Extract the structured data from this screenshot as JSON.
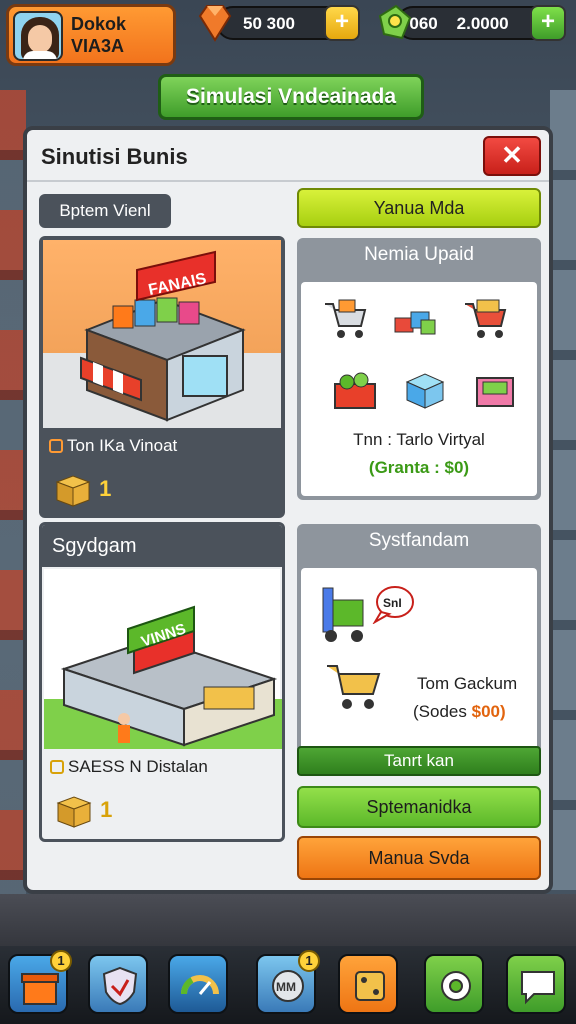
{
  "player": {
    "name_line1": "Dokok",
    "name_line2": "VIA3A"
  },
  "resources": {
    "coins": "50 300",
    "gems_label": "060",
    "gems": "2.0000",
    "plus_label": "+"
  },
  "banner": {
    "title": "Simulasi Vndeainada"
  },
  "modal": {
    "title": "Sinutisi Bunis",
    "close_label": "✕",
    "left_tab": "Bptem Vienl",
    "top_button": "Yanua Mda",
    "card_store": {
      "sign": "FANAIS",
      "label": "Ton IKa Vinoat",
      "count": "1"
    },
    "card_market": {
      "title": "Nemia Upaid",
      "caption": "Tnn : Tarlo Virtyal",
      "sub": "(Granta : $0)"
    },
    "card_warehouse": {
      "title": "Sgydgam",
      "sign": "VINNS",
      "label": "SAESS N Distalan",
      "count": "1"
    },
    "card_system": {
      "title": "Systfandam",
      "bubble": "SnI",
      "caption": "Tom Gackum",
      "sub_prefix": "(Sodes",
      "sub_value": "$00)"
    },
    "btn_dark_green": "Tanrt kan",
    "btn_green": "Sptemanidka",
    "btn_orange": "Manua Svda"
  },
  "nav": {
    "badge_1": "1",
    "badge_2": "1",
    "mid_label": "MM"
  },
  "colors": {
    "accent_green": "#5cb82a",
    "accent_orange": "#ee7514",
    "close_red": "#c8201a"
  }
}
